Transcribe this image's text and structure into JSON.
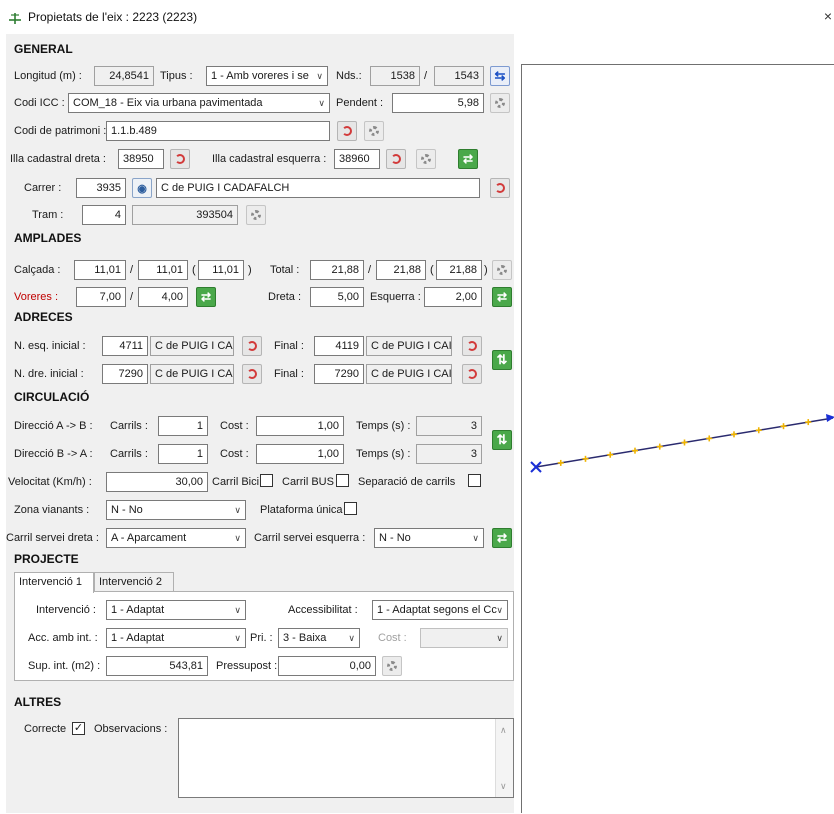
{
  "window": {
    "title": "Propietats de l'eix : 2223 (2223)",
    "close_glyph": "×"
  },
  "general": {
    "section": "GENERAL",
    "longitud_label": "Longitud (m) :",
    "longitud": "24,8541",
    "tipus_label": "Tipus :",
    "tipus": "1 - Amb voreres i se",
    "nds_label": "Nds.:",
    "nds_from": "1538",
    "nds_sep": "/",
    "nds_to": "1543",
    "codi_icc_label": "Codi ICC :",
    "codi_icc": "COM_18 - Eix via urbana pavimentada",
    "pendent_label": "Pendent :",
    "pendent": "5,98",
    "patrimoni_label": "Codi de patrimoni :",
    "patrimoni": "1.1.b.489",
    "illa_dreta_label": "Illa cadastral dreta :",
    "illa_dreta": "38950",
    "illa_esq_label": "Illa cadastral esquerra :",
    "illa_esq": "38960",
    "carrer_label": "Carrer :",
    "carrer_code": "3935",
    "carrer_name": "C de PUIG I CADAFALCH",
    "tram_label": "Tram :",
    "tram": "4",
    "tram_id": "393504"
  },
  "amplades": {
    "section": "AMPLADES",
    "calcada_label": "Calçada :",
    "calcada_1": "11,01",
    "calcada_2": "11,01",
    "calcada_3": "11,01",
    "total_label": "Total :",
    "total_1": "21,88",
    "total_2": "21,88",
    "total_3": "21,88",
    "slash": "/",
    "paren_open": "(",
    "paren_close": ")",
    "voreres_label": "Voreres :",
    "voreres_1": "7,00",
    "voreres_2": "4,00",
    "dreta_label": "Dreta :",
    "dreta": "5,00",
    "esquerra_label": "Esquerra :",
    "esquerra": "2,00"
  },
  "adreces": {
    "section": "ADRECES",
    "esq_inicial_label": "N. esq. inicial :",
    "esq_inicial": "4711",
    "esq_inicial_street": "C de PUIG I CAI",
    "final_label": "Final :",
    "esq_final": "4119",
    "esq_final_street": "C de PUIG I CAI",
    "dre_inicial_label": "N. dre. inicial :",
    "dre_inicial": "7290",
    "dre_inicial_street": "C de PUIG I CAI",
    "dre_final": "7290",
    "dre_final_street": "C de PUIG I CAI"
  },
  "circulacio": {
    "section": "CIRCULACIÓ",
    "ab_label": "Direcció A -> B :",
    "ba_label": "Direcció B -> A :",
    "carrils_label": "Carrils :",
    "cost_label": "Cost :",
    "temps_label": "Temps (s) :",
    "ab_carrils": "1",
    "ab_cost": "1,00",
    "ab_temps": "3",
    "ba_carrils": "1",
    "ba_cost": "1,00",
    "ba_temps": "3",
    "velocitat_label": "Velocitat (Km/h) :",
    "velocitat": "30,00",
    "carril_bici_label": "Carril Bici",
    "carril_bus_label": "Carril BUS",
    "separacio_label": "Separació de carrils",
    "zona_label": "Zona vianants :",
    "zona": "N - No",
    "plataforma_label": "Plataforma única",
    "servei_dreta_label": "Carril servei dreta :",
    "servei_dreta": "A - Aparcament",
    "servei_esq_label": "Carril servei esquerra :",
    "servei_esq": "N - No"
  },
  "projecte": {
    "section": "PROJECTE",
    "tabs": [
      "Intervenció 1",
      "Intervenció 2"
    ],
    "intervencio_label": "Intervenció :",
    "intervencio": "1 - Adaptat",
    "accessibilitat_label": "Accessibilitat :",
    "accessibilitat": "1 - Adaptat segons el Cc",
    "acc_int_label": "Acc. amb int. :",
    "acc_int": "1 - Adaptat",
    "pri_label": "Pri. :",
    "pri": "3 - Baixa",
    "cost_label": "Cost :",
    "cost": "",
    "sup_label": "Sup. int. (m2) :",
    "sup": "543,81",
    "pressupost_label": "Pressupost :",
    "pressupost": "0,00"
  },
  "altres": {
    "section": "ALTRES",
    "correcte_label": "Correcte",
    "correcte_checked": "✓",
    "observacions_label": "Observacions :",
    "observacions": ""
  },
  "icons": {
    "chevron": "∨",
    "swap": "⇄",
    "updown": "⇅",
    "flip": "⇆",
    "eye": "◉",
    "up": "∧",
    "down": "∨"
  },
  "map": {
    "line_color": "#2a2a6e",
    "vertex_color": "#f0b400",
    "start_color": "#1a2fd6",
    "end_color": "#1a2fd6"
  }
}
